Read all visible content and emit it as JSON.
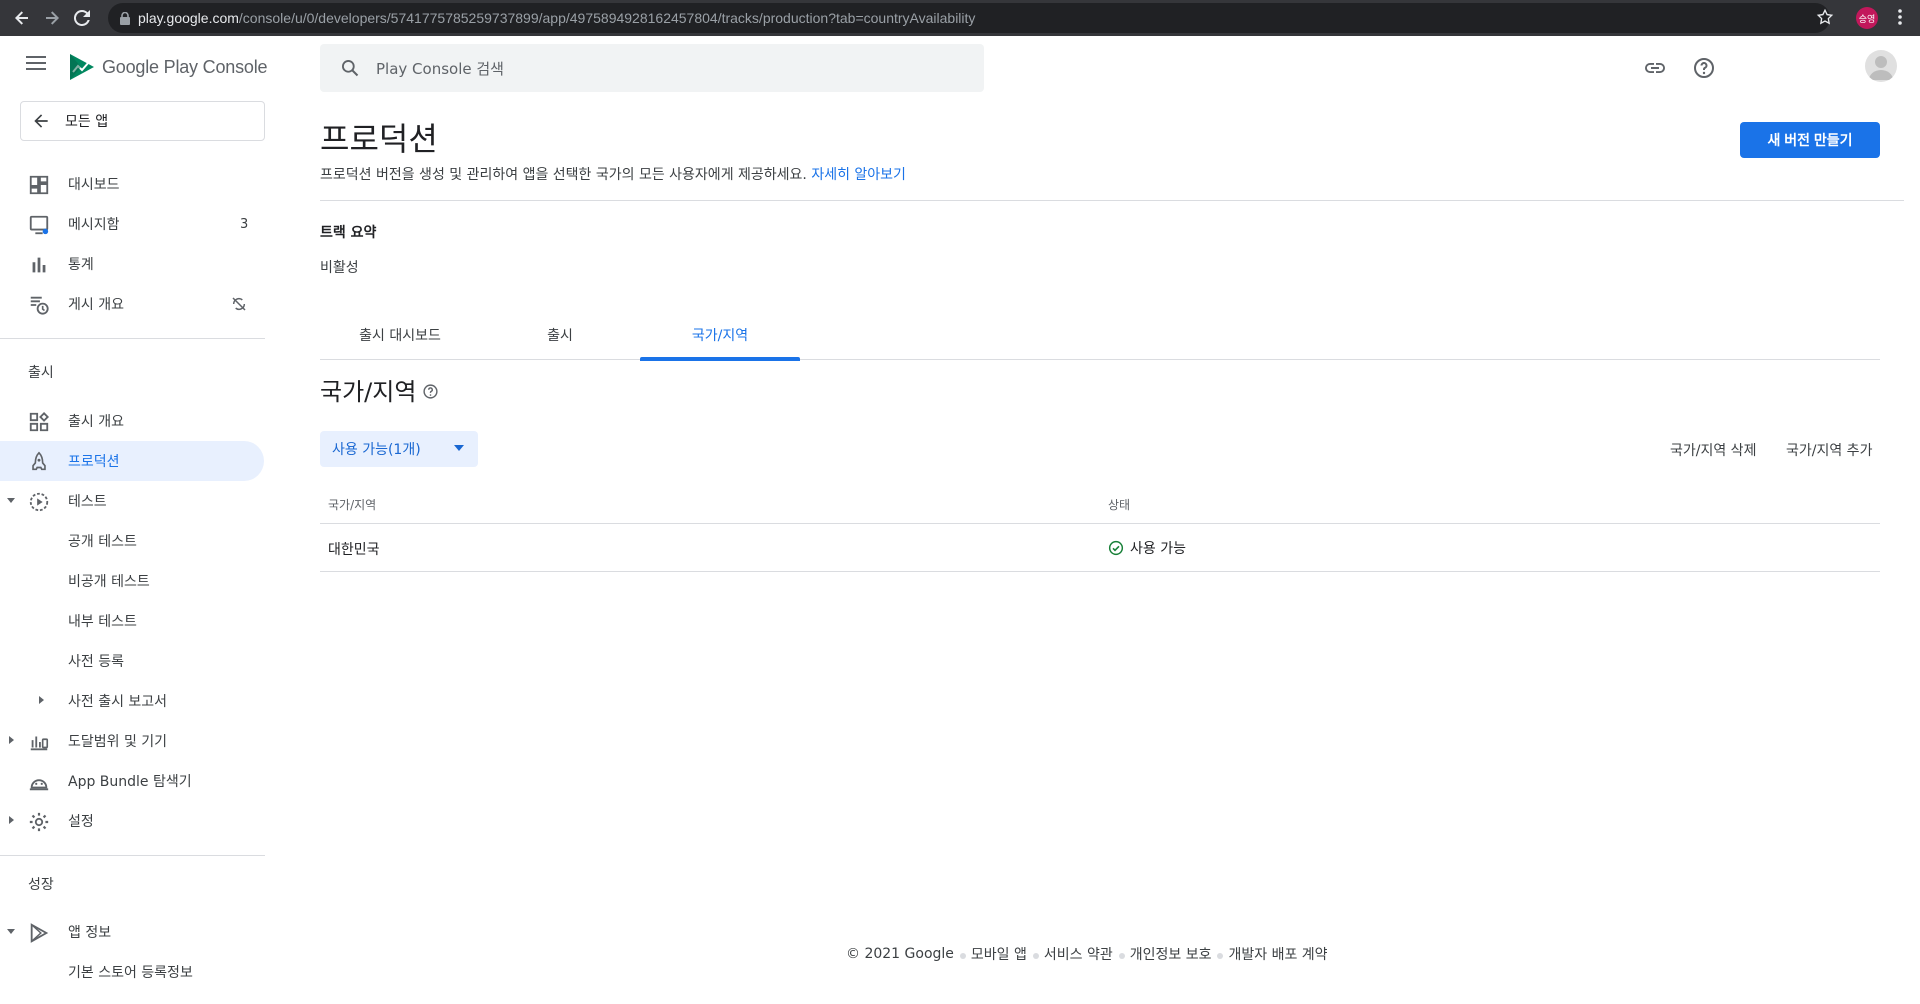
{
  "browser": {
    "url_host": "play.google.com",
    "url_path": "/console/u/0/developers/5741775785259737899/app/4975894928162457804/tracks/production?tab=countryAvailability",
    "profile_initials": "승영"
  },
  "header": {
    "brand": "Google Play Console",
    "search_placeholder": "Play Console 검색"
  },
  "sidebar": {
    "back_label": "모든 앱",
    "items_top": [
      {
        "label": "대시보드",
        "icon": "dashboard-icon"
      },
      {
        "label": "메시지함",
        "icon": "inbox-icon",
        "count": "3"
      },
      {
        "label": "통계",
        "icon": "bar-chart-icon"
      },
      {
        "label": "게시 개요",
        "icon": "publishing-icon",
        "badge_icon": "sync-disabled-icon"
      }
    ],
    "section_release": "출시",
    "items_release": [
      {
        "label": "출시 개요",
        "icon": "release-overview-icon"
      },
      {
        "label": "프로덕션",
        "icon": "production-icon",
        "active": true
      },
      {
        "label": "테스트",
        "icon": "testing-icon"
      },
      {
        "label": "공개 테스트"
      },
      {
        "label": "비공개 테스트"
      },
      {
        "label": "내부 테스트"
      },
      {
        "label": "사전 등록"
      },
      {
        "label": "사전 출시 보고서"
      },
      {
        "label": "도달범위 및 기기",
        "icon": "reach-icon"
      },
      {
        "label": "App Bundle 탐색기",
        "icon": "bundle-icon"
      },
      {
        "label": "설정",
        "icon": "settings-icon"
      }
    ],
    "section_growth": "성장",
    "items_growth": [
      {
        "label": "앱 정보",
        "icon": "play-store-icon"
      },
      {
        "label": "기본 스토어 등록정보"
      }
    ]
  },
  "main": {
    "title": "프로덕션",
    "description": "프로덕션 버전을 생성 및 관리하여 앱을 선택한 국가의 모든 사용자에게 제공하세요.",
    "learn_more": "자세히 알아보기",
    "create_button": "새 버전 만들기",
    "track_summary_label": "트랙 요약",
    "track_summary_value": "비활성",
    "tabs": [
      "출시 대시보드",
      "출시",
      "국가/지역"
    ],
    "active_tab": "국가/지역",
    "section_title": "국가/지역",
    "filter_label": "사용 가능(1개)",
    "remove_button": "국가/지역 삭제",
    "add_button": "국가/지역 추가",
    "table": {
      "headers": [
        "국가/지역",
        "상태"
      ],
      "rows": [
        {
          "country": "대한민국",
          "status": "사용 가능"
        }
      ]
    }
  },
  "footer": {
    "copyright": "© 2021 Google",
    "links": [
      "모바일 앱",
      "서비스 약관",
      "개인정보 보호",
      "개발자 배포 계약"
    ]
  }
}
